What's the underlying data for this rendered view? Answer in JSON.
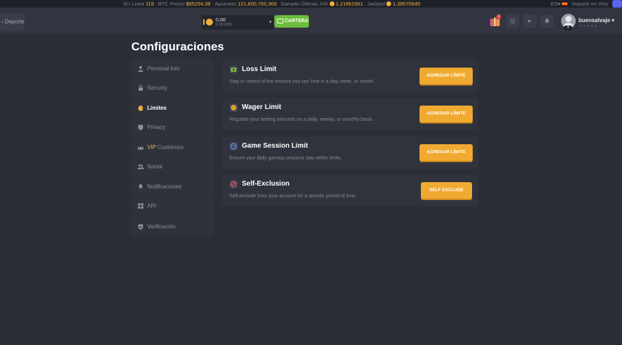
{
  "ticker": {
    "online_label": "En Linea",
    "online_value": "119",
    "btc_label": "BTC Precio",
    "btc_value": "$85294.39",
    "bets_label": "Apuestas",
    "bets_value": "121,800,700,368",
    "won_label": "Ganado Últimas 24h",
    "won_value": "1.21861661",
    "jackpot_label": "Jackpot",
    "jackpot_value": "1.39570645",
    "lang": "ES",
    "support": "Soporte en Vivo"
  },
  "header": {
    "deporte": "Deporte",
    "wallet_amount": "0.00",
    "wallet_usd": "0.00 USD",
    "cartera": "CARTERA",
    "gift_badge": "2",
    "username": "buensalvaje",
    "level": "0"
  },
  "page": {
    "title": "Configuraciones"
  },
  "sidebar": {
    "items": [
      {
        "label": "Personal Info",
        "icon": "person-icon"
      },
      {
        "label": "Security",
        "icon": "lock-icon"
      },
      {
        "label": "Limites",
        "icon": "hand-icon"
      },
      {
        "label": "Privacy",
        "icon": "shield-icon"
      },
      {
        "label": "Customize",
        "vip": "VIP",
        "icon": "crown-icon"
      },
      {
        "label": "Social",
        "icon": "people-icon"
      },
      {
        "label": "Notificaciones",
        "icon": "bell-icon"
      },
      {
        "label": "API",
        "icon": "grid-icon"
      },
      {
        "label": "Verificación",
        "icon": "check-shield-icon"
      }
    ],
    "active": "Limites"
  },
  "cards": [
    {
      "title": "Loss Limit",
      "desc": "Stay in control of the amount you can lose in a day, week, or month.",
      "button": "AGREGAR LÍMITE",
      "icon": "money-icon",
      "color": "#7bbf3a"
    },
    {
      "title": "Wager Limit",
      "desc": "Regulate your betting amounts on a daily, weekly, or monthly basis.",
      "button": "AGREGAR LÍMITE",
      "icon": "coin-icon",
      "color": "#f0b03c"
    },
    {
      "title": "Game Session Limit",
      "desc": "Ensure your daily gaming sessions stay within limits.",
      "button": "AGREGAR LÍMITE",
      "icon": "clock-icon",
      "color": "#5b8def"
    },
    {
      "title": "Self-Exclusion",
      "desc": "Self-exclude from your account for a specific period of time.",
      "button": "SELF EXCLUDE",
      "icon": "block-icon",
      "color": "#e2505c"
    }
  ],
  "colors": {
    "accent": "#f0aa32",
    "background": "#2b2e37",
    "panel": "#30333c",
    "green": "#6cbd3c"
  }
}
